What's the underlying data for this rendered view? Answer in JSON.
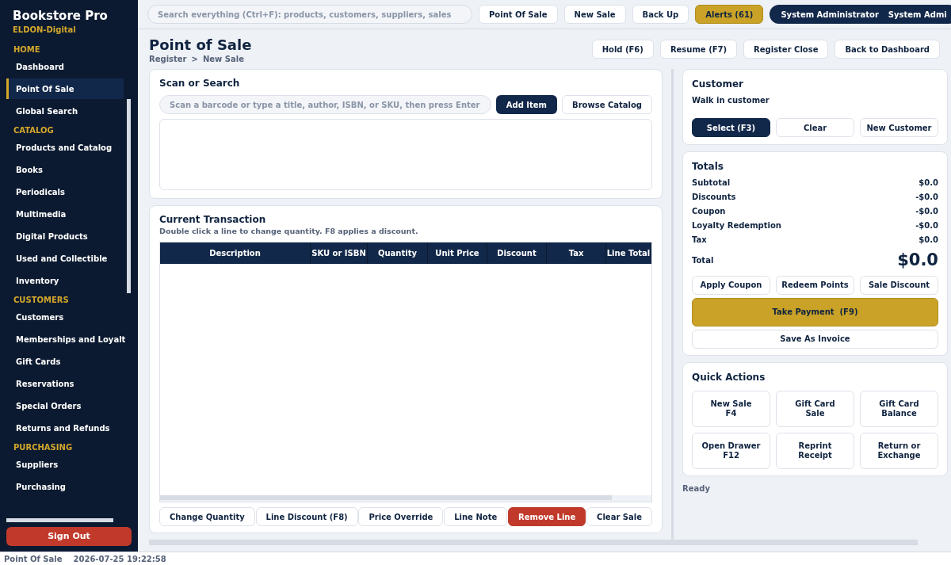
{
  "app": {
    "title": "Bookstore Pro",
    "subtitle": "ELDON-Digital"
  },
  "sidebar": {
    "sections": [
      {
        "heading": "HOME",
        "items": [
          {
            "label": "Dashboard",
            "selected": false
          },
          {
            "label": "Point Of Sale",
            "selected": true
          },
          {
            "label": "Global Search",
            "selected": false
          }
        ]
      },
      {
        "heading": "CATALOG",
        "items": [
          {
            "label": "Products and Catalog",
            "selected": false
          },
          {
            "label": "Books",
            "selected": false
          },
          {
            "label": "Periodicals",
            "selected": false
          },
          {
            "label": "Multimedia",
            "selected": false
          },
          {
            "label": "Digital Products",
            "selected": false
          },
          {
            "label": "Used and Collectible",
            "selected": false
          },
          {
            "label": "Inventory",
            "selected": false
          }
        ]
      },
      {
        "heading": "CUSTOMERS",
        "items": [
          {
            "label": "Customers",
            "selected": false
          },
          {
            "label": "Memberships and Loyalt",
            "selected": false
          },
          {
            "label": "Gift Cards",
            "selected": false
          },
          {
            "label": "Reservations",
            "selected": false
          },
          {
            "label": "Special Orders",
            "selected": false
          },
          {
            "label": "Returns and Refunds",
            "selected": false
          }
        ]
      },
      {
        "heading": "PURCHASING",
        "items": [
          {
            "label": "Suppliers",
            "selected": false
          },
          {
            "label": "Purchasing",
            "selected": false
          }
        ]
      }
    ],
    "sign_out": "Sign Out"
  },
  "top_bar": {
    "search": {
      "placeholder": "Search everything (Ctrl+F): products, customers, suppliers, sales"
    },
    "buttons": [
      {
        "label": "Point Of Sale",
        "kind": "plain"
      },
      {
        "label": "New Sale",
        "kind": "plain"
      },
      {
        "label": "Back Up",
        "kind": "plain"
      },
      {
        "label": "Alerts (61)",
        "kind": "alert"
      }
    ],
    "user": {
      "name": "System Administrator",
      "role": "System Admi"
    }
  },
  "page": {
    "title": "Point of Sale",
    "breadcrumb": [
      "Register",
      "New Sale"
    ],
    "separator": ">",
    "actions": [
      "Hold (F6)",
      "Resume (F7)",
      "Register Close",
      "Back to Dashboard"
    ]
  },
  "scan": {
    "title": "Scan or Search",
    "placeholder": "Scan a barcode or type a title, author, ISBN, or SKU, then press Enter",
    "add_button": "Add Item",
    "browse_button": "Browse Catalog"
  },
  "transaction": {
    "title": "Current Transaction",
    "hint": "Double click a line to change quantity. F8 applies a discount.",
    "columns": [
      "Description",
      "SKU or ISBN",
      "Quantity",
      "Unit Price",
      "Discount",
      "Tax",
      "Line Total"
    ],
    "actions": [
      {
        "label": "Change Quantity",
        "kind": "plain"
      },
      {
        "label": "Line Discount (F8)",
        "kind": "plain"
      },
      {
        "label": "Price Override",
        "kind": "plain"
      },
      {
        "label": "Line Note",
        "kind": "plain"
      },
      {
        "label": "Remove Line",
        "kind": "danger"
      },
      {
        "label": "Clear Sale",
        "kind": "plain"
      }
    ]
  },
  "customer": {
    "title": "Customer",
    "name": "Walk in customer",
    "buttons": [
      {
        "label": "Select (F3)",
        "kind": "primary"
      },
      {
        "label": "Clear",
        "kind": "plain"
      },
      {
        "label": "New Customer",
        "kind": "plain"
      }
    ]
  },
  "totals": {
    "title": "Totals",
    "rows": [
      {
        "label": "Subtotal",
        "value": "$0.0"
      },
      {
        "label": "Discounts",
        "value": "-$0.0"
      },
      {
        "label": "Coupon",
        "value": "-$0.0"
      },
      {
        "label": "Loyalty Redemption",
        "value": "-$0.0"
      },
      {
        "label": "Tax",
        "value": "$0.0"
      }
    ],
    "total": {
      "label": "Total",
      "value": "$0.0"
    },
    "buttons": [
      "Apply Coupon",
      "Redeem Points",
      "Sale Discount"
    ],
    "pay": "Take Payment  (F9)",
    "invoice": "Save As Invoice"
  },
  "quick_actions": {
    "title": "Quick Actions",
    "items": [
      "New Sale\nF4",
      "Gift Card\nSale",
      "Gift Card\nBalance",
      "Open Drawer\nF12",
      "Reprint\nReceipt",
      "Return or\nExchange"
    ]
  },
  "status_text": "Ready",
  "status_bar": {
    "module": "Point Of Sale",
    "time": "2026-07-25 19:22:58"
  }
}
